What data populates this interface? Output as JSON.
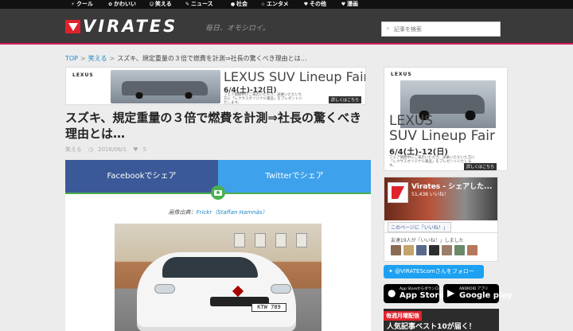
{
  "nav": {
    "items": [
      {
        "label": "クール",
        "icon": "lightning-icon",
        "glyph": "⚡"
      },
      {
        "label": "かわいい",
        "icon": "paw-icon",
        "glyph": "✿"
      },
      {
        "label": "笑える",
        "icon": "smile-icon",
        "glyph": "☺"
      },
      {
        "label": "ニュース",
        "icon": "news-icon",
        "glyph": "✎"
      },
      {
        "label": "社会",
        "icon": "globe-icon",
        "glyph": "●"
      },
      {
        "label": "エンタメ",
        "icon": "star-icon",
        "glyph": "☆"
      },
      {
        "label": "その他",
        "icon": "heart-icon",
        "glyph": "♥"
      },
      {
        "label": "漫画",
        "icon": "heart-icon",
        "glyph": "♥"
      }
    ]
  },
  "header": {
    "logo_text": "VIRATES",
    "tagline": "毎日、オモシロイ。",
    "search_placeholder": "記事を検索",
    "accent": "#d81b60"
  },
  "breadcrumb": {
    "home": "TOP",
    "category": "笑える",
    "sep": ">",
    "current": "スズキ、規定重量の３倍で燃費を計測⇒社長の驚くべき理由とは…"
  },
  "ad_top": {
    "brand": "LEXUS",
    "headline": "LEXUS SUV Lineup Fair",
    "date": "6/4(土)-12(日)",
    "fine": "フェア期間中にご来店いただき、試乗いただいた方に「レクサスオリジナル賞品」をプレゼントいたします。",
    "more": "詳しくはこちら"
  },
  "article": {
    "title": "スズキ、規定重量の３倍で燃費を計測⇒社長の驚くべき理由とは…",
    "category": "笑える",
    "date": "2016/06/1",
    "likes": "5",
    "credit_prefix": "画像出典：",
    "credit_link": "Frickr（Staffan Hamnäs）",
    "plate": "KTW 789"
  },
  "share": {
    "facebook": "Facebookでシェア",
    "twitter": "Twitterでシェア",
    "facebook_color": "#3b5998",
    "twitter_color": "#3ea1ec"
  },
  "sidebar": {
    "ad": {
      "brand": "LEXUS",
      "line1": "LEXUS",
      "line2": "SUV Lineup Fair",
      "date": "6/4(土)-12(日)",
      "fine": "フェア期間中にご来店いただき、試乗いただいた方に「レクサスオリジナル賞品」をプレゼントいたします。",
      "more": "詳しくはこちら"
    },
    "fb": {
      "name": "Virates - シェアした...",
      "likes": "51,438 いいね！",
      "like_button": "このページに「いいね！」"
    },
    "friends_text": "友達19人が「いいね！」しました",
    "follow": "@VIRATEScomさんをフォロー",
    "appstore": {
      "small": "App Storeからダウンロード",
      "big": "App Store"
    },
    "googleplay": {
      "small": "ANDROID アプリ",
      "big": "Google play"
    },
    "mail": {
      "tag": "毎週月曜配信",
      "text": "人気記事ベスト10が届く！"
    }
  }
}
